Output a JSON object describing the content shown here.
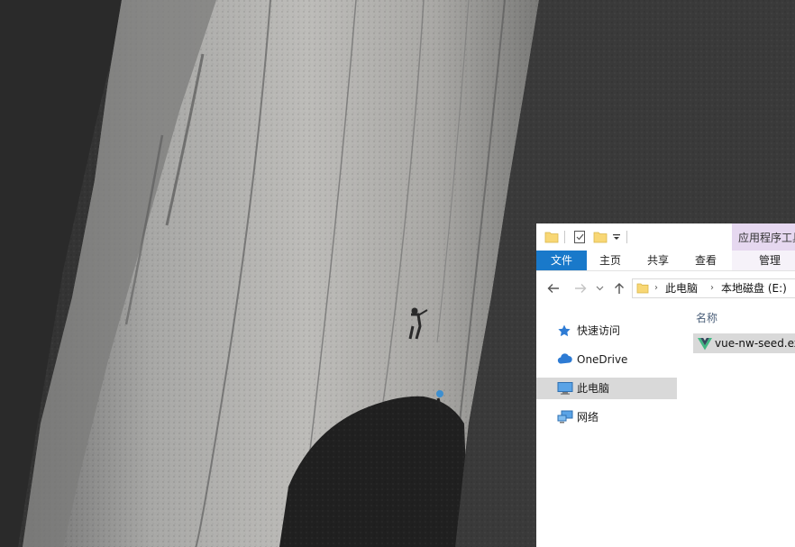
{
  "explorer": {
    "quick_access_toolbar": {
      "items": [
        "folder-icon",
        "properties-check-icon",
        "new-folder-icon",
        "customize-dropdown-icon"
      ]
    },
    "contextual_tab_group": "应用程序工具",
    "ribbon_tabs": {
      "file": "文件",
      "home": "主页",
      "share": "共享",
      "view": "查看",
      "manage": "管理"
    },
    "address_bar": {
      "breadcrumbs": [
        "此电脑",
        "本地磁盘 (E:)"
      ]
    },
    "nav_pane": {
      "items": [
        {
          "label": "快速访问",
          "icon": "star-icon"
        },
        {
          "label": "OneDrive",
          "icon": "cloud-icon"
        },
        {
          "label": "此电脑",
          "icon": "computer-icon",
          "selected": true
        },
        {
          "label": "网络",
          "icon": "network-icon"
        }
      ]
    },
    "file_list": {
      "column_name": "名称",
      "files": [
        {
          "name": "vue-nw-seed.exe",
          "icon": "vue-app-icon",
          "selected": true
        }
      ]
    }
  },
  "colors": {
    "file_tab": "#1979ca",
    "contextual_tab": "#e6d8f0",
    "selection": "#d9d9d9",
    "column_header": "#4c607a",
    "vue_green": "#41b883",
    "vue_dark": "#35495e"
  }
}
